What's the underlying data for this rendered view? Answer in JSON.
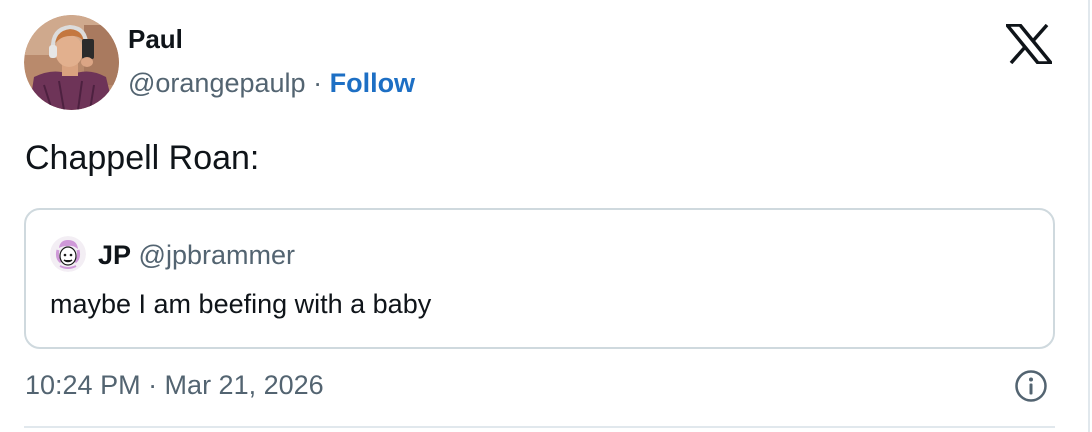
{
  "author": {
    "display_name": "Paul",
    "handle": "@orangepaulp",
    "separator": "·",
    "follow_label": "Follow",
    "avatar_icon": "profile-photo"
  },
  "brand": {
    "icon": "x-logo-icon"
  },
  "tweet": {
    "text": "Chappell Roan:"
  },
  "quoted_tweet": {
    "display_name": "JP",
    "handle": "@jpbrammer",
    "text": "maybe I am beefing with a baby",
    "avatar_icon": "profile-photo"
  },
  "footer": {
    "timestamp": "10:24 PM · Mar 21, 2026",
    "info_icon": "info-icon"
  },
  "colors": {
    "link": "#1d6fc4",
    "text": "#0f1419",
    "muted": "#536471",
    "border": "#cfd9de"
  }
}
